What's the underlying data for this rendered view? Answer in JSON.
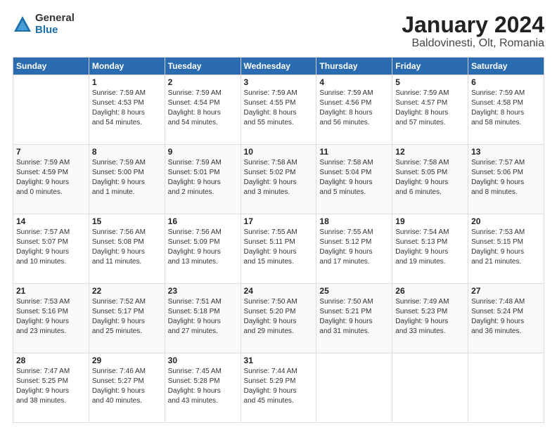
{
  "logo": {
    "general": "General",
    "blue": "Blue"
  },
  "title": "January 2024",
  "subtitle": "Baldovinesti, Olt, Romania",
  "days_header": [
    "Sunday",
    "Monday",
    "Tuesday",
    "Wednesday",
    "Thursday",
    "Friday",
    "Saturday"
  ],
  "weeks": [
    [
      {
        "day": "",
        "info": ""
      },
      {
        "day": "1",
        "info": "Sunrise: 7:59 AM\nSunset: 4:53 PM\nDaylight: 8 hours\nand 54 minutes."
      },
      {
        "day": "2",
        "info": "Sunrise: 7:59 AM\nSunset: 4:54 PM\nDaylight: 8 hours\nand 54 minutes."
      },
      {
        "day": "3",
        "info": "Sunrise: 7:59 AM\nSunset: 4:55 PM\nDaylight: 8 hours\nand 55 minutes."
      },
      {
        "day": "4",
        "info": "Sunrise: 7:59 AM\nSunset: 4:56 PM\nDaylight: 8 hours\nand 56 minutes."
      },
      {
        "day": "5",
        "info": "Sunrise: 7:59 AM\nSunset: 4:57 PM\nDaylight: 8 hours\nand 57 minutes."
      },
      {
        "day": "6",
        "info": "Sunrise: 7:59 AM\nSunset: 4:58 PM\nDaylight: 8 hours\nand 58 minutes."
      }
    ],
    [
      {
        "day": "7",
        "info": "Sunrise: 7:59 AM\nSunset: 4:59 PM\nDaylight: 9 hours\nand 0 minutes."
      },
      {
        "day": "8",
        "info": "Sunrise: 7:59 AM\nSunset: 5:00 PM\nDaylight: 9 hours\nand 1 minute."
      },
      {
        "day": "9",
        "info": "Sunrise: 7:59 AM\nSunset: 5:01 PM\nDaylight: 9 hours\nand 2 minutes."
      },
      {
        "day": "10",
        "info": "Sunrise: 7:58 AM\nSunset: 5:02 PM\nDaylight: 9 hours\nand 3 minutes."
      },
      {
        "day": "11",
        "info": "Sunrise: 7:58 AM\nSunset: 5:04 PM\nDaylight: 9 hours\nand 5 minutes."
      },
      {
        "day": "12",
        "info": "Sunrise: 7:58 AM\nSunset: 5:05 PM\nDaylight: 9 hours\nand 6 minutes."
      },
      {
        "day": "13",
        "info": "Sunrise: 7:57 AM\nSunset: 5:06 PM\nDaylight: 9 hours\nand 8 minutes."
      }
    ],
    [
      {
        "day": "14",
        "info": "Sunrise: 7:57 AM\nSunset: 5:07 PM\nDaylight: 9 hours\nand 10 minutes."
      },
      {
        "day": "15",
        "info": "Sunrise: 7:56 AM\nSunset: 5:08 PM\nDaylight: 9 hours\nand 11 minutes."
      },
      {
        "day": "16",
        "info": "Sunrise: 7:56 AM\nSunset: 5:09 PM\nDaylight: 9 hours\nand 13 minutes."
      },
      {
        "day": "17",
        "info": "Sunrise: 7:55 AM\nSunset: 5:11 PM\nDaylight: 9 hours\nand 15 minutes."
      },
      {
        "day": "18",
        "info": "Sunrise: 7:55 AM\nSunset: 5:12 PM\nDaylight: 9 hours\nand 17 minutes."
      },
      {
        "day": "19",
        "info": "Sunrise: 7:54 AM\nSunset: 5:13 PM\nDaylight: 9 hours\nand 19 minutes."
      },
      {
        "day": "20",
        "info": "Sunrise: 7:53 AM\nSunset: 5:15 PM\nDaylight: 9 hours\nand 21 minutes."
      }
    ],
    [
      {
        "day": "21",
        "info": "Sunrise: 7:53 AM\nSunset: 5:16 PM\nDaylight: 9 hours\nand 23 minutes."
      },
      {
        "day": "22",
        "info": "Sunrise: 7:52 AM\nSunset: 5:17 PM\nDaylight: 9 hours\nand 25 minutes."
      },
      {
        "day": "23",
        "info": "Sunrise: 7:51 AM\nSunset: 5:18 PM\nDaylight: 9 hours\nand 27 minutes."
      },
      {
        "day": "24",
        "info": "Sunrise: 7:50 AM\nSunset: 5:20 PM\nDaylight: 9 hours\nand 29 minutes."
      },
      {
        "day": "25",
        "info": "Sunrise: 7:50 AM\nSunset: 5:21 PM\nDaylight: 9 hours\nand 31 minutes."
      },
      {
        "day": "26",
        "info": "Sunrise: 7:49 AM\nSunset: 5:23 PM\nDaylight: 9 hours\nand 33 minutes."
      },
      {
        "day": "27",
        "info": "Sunrise: 7:48 AM\nSunset: 5:24 PM\nDaylight: 9 hours\nand 36 minutes."
      }
    ],
    [
      {
        "day": "28",
        "info": "Sunrise: 7:47 AM\nSunset: 5:25 PM\nDaylight: 9 hours\nand 38 minutes."
      },
      {
        "day": "29",
        "info": "Sunrise: 7:46 AM\nSunset: 5:27 PM\nDaylight: 9 hours\nand 40 minutes."
      },
      {
        "day": "30",
        "info": "Sunrise: 7:45 AM\nSunset: 5:28 PM\nDaylight: 9 hours\nand 43 minutes."
      },
      {
        "day": "31",
        "info": "Sunrise: 7:44 AM\nSunset: 5:29 PM\nDaylight: 9 hours\nand 45 minutes."
      },
      {
        "day": "",
        "info": ""
      },
      {
        "day": "",
        "info": ""
      },
      {
        "day": "",
        "info": ""
      }
    ]
  ]
}
